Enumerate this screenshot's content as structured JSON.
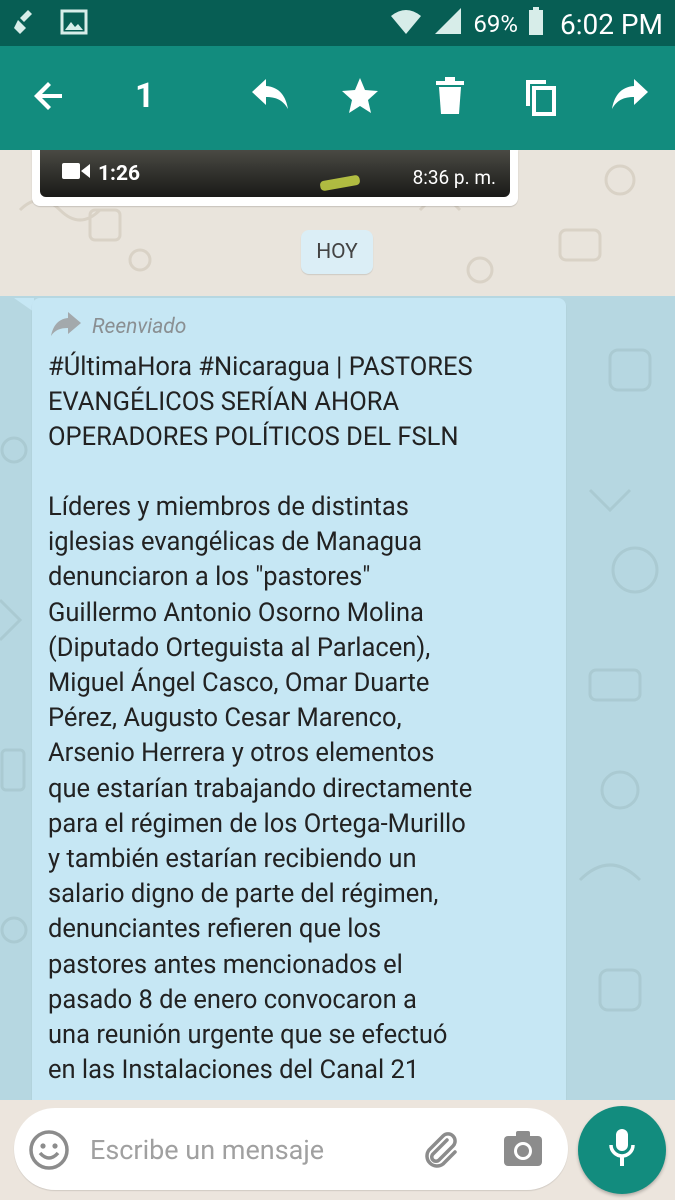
{
  "status_bar": {
    "battery_percent": "69%",
    "time": "6:02 PM",
    "icons": [
      "cleaner-icon",
      "image-icon",
      "wifi-icon",
      "signal-icon",
      "battery-icon"
    ]
  },
  "toolbar": {
    "selected_count": "1",
    "actions": [
      "back-arrow-icon",
      "reply-icon",
      "star-icon",
      "delete-icon",
      "copy-icon",
      "forward-icon"
    ]
  },
  "video_message": {
    "duration": "1:26",
    "time": "8:36 p. m."
  },
  "date_divider": "HOY",
  "message": {
    "forwarded_label": "Reenviado",
    "title": "#ÚltimaHora #Nicaragua | PASTORES\nEVANGÉLICOS SERÍAN AHORA\nOPERADORES POLÍTICOS DEL FSLN",
    "body": "Líderes y miembros de distintas\niglesias evangélicas de Managua\ndenunciaron a los \"pastores\"\nGuillermo Antonio Osorno Molina\n(Diputado Orteguista al Parlacen),\nMiguel Ángel Casco, Omar Duarte\nPérez, Augusto Cesar Marenco,\nArsenio Herrera y otros elementos\nque estarían trabajando directamente\npara el régimen de los Ortega-Murillo\ny también estarían recibiendo un\nsalario digno de parte del régimen,\ndenunciantes refieren que los\npastores antes mencionados el\npasado 8 de enero convocaron a\nuna reunión urgente que se efectuó\nen las Instalaciones del Canal 21"
  },
  "composer": {
    "placeholder": "Escribe un mensaje"
  },
  "colors": {
    "header_dark": "#075e54",
    "header": "#128c7e",
    "bubble_selected": "#c6e7f4",
    "chat_background": "#e9e4dc"
  }
}
